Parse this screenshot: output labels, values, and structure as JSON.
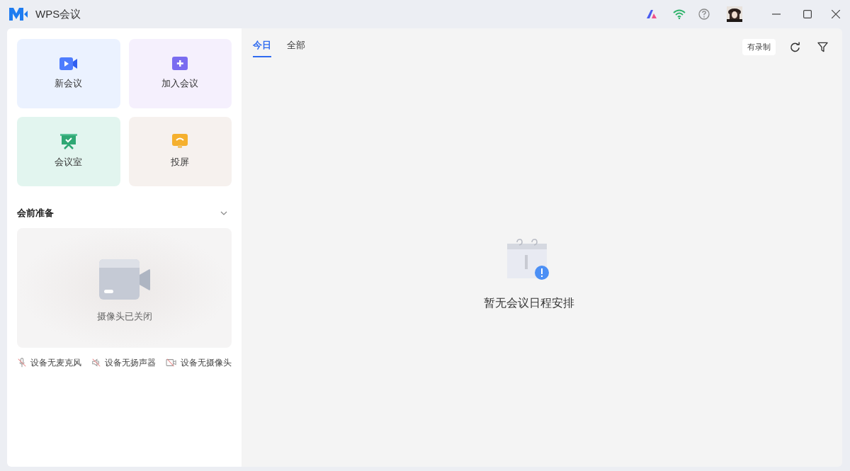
{
  "window": {
    "title": "WPS会议"
  },
  "quick_actions": [
    {
      "kind": "new",
      "label": "新会议"
    },
    {
      "kind": "join",
      "label": "加入会议"
    },
    {
      "kind": "room",
      "label": "会议室"
    },
    {
      "kind": "cast",
      "label": "投屏"
    }
  ],
  "prep": {
    "title": "会前准备",
    "expanded": true,
    "camera_status": "摄像头已关闭",
    "devices": [
      {
        "kind": "mic",
        "label": "设备无麦克风"
      },
      {
        "kind": "speaker",
        "label": "设备无扬声器"
      },
      {
        "kind": "camera",
        "label": "设备无摄像头"
      }
    ]
  },
  "tabs": [
    {
      "label": "今日",
      "selected": true
    },
    {
      "label": "全部",
      "selected": false
    }
  ],
  "filter_tag": "有录制",
  "empty_state": "暂无会议日程安排"
}
